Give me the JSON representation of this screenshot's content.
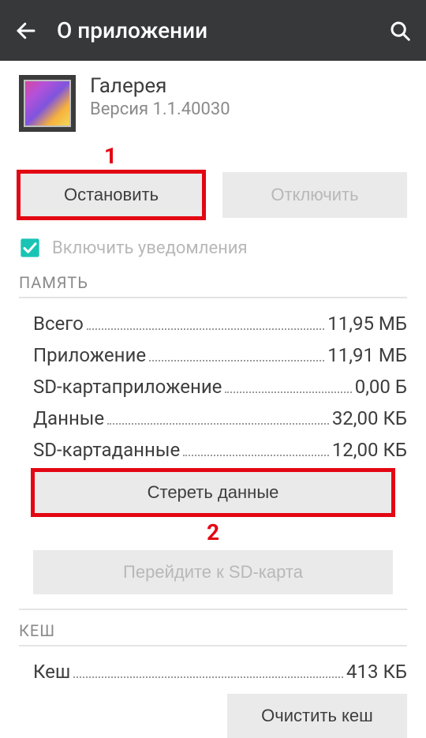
{
  "header": {
    "title": "О приложении"
  },
  "app": {
    "name": "Галерея",
    "version": "Версия 1.1.40030"
  },
  "annotations": {
    "one": "1",
    "two": "2"
  },
  "buttons": {
    "stop": "Остановить",
    "disable": "Отключить",
    "clear_data": "Стереть данные",
    "move_sd": "Перейдите к SD-карта",
    "clear_cache": "Очистить кеш"
  },
  "notifications": {
    "label": "Включить уведомления",
    "checked": true
  },
  "sections": {
    "memory": "ПАМЯТЬ",
    "cache": "КЕШ"
  },
  "memory": {
    "rows": [
      {
        "label": "Всего",
        "value": "11,95 МБ"
      },
      {
        "label": "Приложение",
        "value": "11,91 МБ"
      },
      {
        "label": "SD-картаприложение",
        "value": "0,00 Б"
      },
      {
        "label": "Данные",
        "value": "32,00 КБ"
      },
      {
        "label": "SD-картаданные",
        "value": "12,00 КБ"
      }
    ]
  },
  "cache": {
    "row": {
      "label": "Кеш",
      "value": "413 КБ"
    }
  }
}
